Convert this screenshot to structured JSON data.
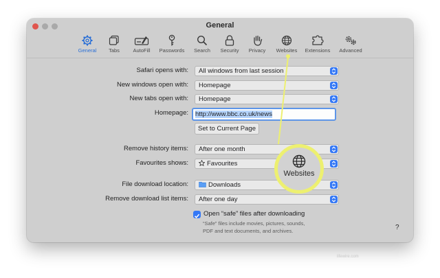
{
  "window": {
    "title": "General",
    "colors": {
      "accent": "#3478f6",
      "callout": "#edf070",
      "close": "#e0564e"
    }
  },
  "toolbar": {
    "items": [
      {
        "label": "General",
        "icon": "gear-icon",
        "active": true
      },
      {
        "label": "Tabs",
        "icon": "tabs-icon"
      },
      {
        "label": "AutoFill",
        "icon": "autofill-icon"
      },
      {
        "label": "Passwords",
        "icon": "key-icon"
      },
      {
        "label": "Search",
        "icon": "search-icon"
      },
      {
        "label": "Security",
        "icon": "lock-icon"
      },
      {
        "label": "Privacy",
        "icon": "hand-icon"
      },
      {
        "label": "Websites",
        "icon": "globe-icon"
      },
      {
        "label": "Extensions",
        "icon": "puzzle-icon"
      },
      {
        "label": "Advanced",
        "icon": "gears-icon"
      }
    ]
  },
  "settings": {
    "safari_opens_with": {
      "label": "Safari opens with:",
      "value": "All windows from last session"
    },
    "new_windows": {
      "label": "New windows open with:",
      "value": "Homepage"
    },
    "new_tabs": {
      "label": "New tabs open with:",
      "value": "Homepage"
    },
    "homepage": {
      "label": "Homepage:",
      "value": "http://www.bbc.co.uk/news"
    },
    "set_current_page": "Set to Current Page",
    "remove_history": {
      "label": "Remove history items:",
      "value": "After one month"
    },
    "favourites": {
      "label": "Favourites shows:",
      "value": "Favourites"
    },
    "download_location": {
      "label": "File download location:",
      "value": "Downloads"
    },
    "remove_download": {
      "label": "Remove download list items:",
      "value": "After one day"
    },
    "open_safe": {
      "label": "Open “safe” files after downloading",
      "checked": true
    },
    "hint_line1": "“Safe” files include movies, pictures, sounds,",
    "hint_line2": "PDF and text documents, and archives.",
    "help": "?"
  },
  "callout": {
    "label": "Websites",
    "icon": "globe-icon"
  },
  "watermark": "lifewire.com"
}
